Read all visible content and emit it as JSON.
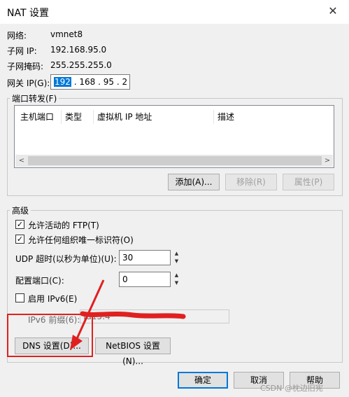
{
  "window": {
    "title": "NAT 设置",
    "close_glyph": "✕"
  },
  "info": {
    "network_label": "网络:",
    "network_value": "vmnet8",
    "subnet_ip_label": "子网 IP:",
    "subnet_ip_value": "192.168.95.0",
    "subnet_mask_label": "子网掩码:",
    "subnet_mask_value": "255.255.255.0",
    "gateway_label": "网关 IP(G):",
    "gateway_octets": [
      "192",
      "168",
      "95",
      "2"
    ]
  },
  "port_forwarding": {
    "label": "端口转发(F)",
    "columns": [
      "主机端口",
      "类型",
      "虚拟机 IP 地址",
      "描述"
    ],
    "rows": [],
    "add_label": "添加(A)...",
    "remove_label": "移除(R)",
    "properties_label": "属性(P)"
  },
  "advanced": {
    "label": "高级",
    "allow_ftp_label": "允许活动的 FTP(T)",
    "allow_ftp_checked": true,
    "allow_uuid_label": "允许任何组织唯一标识符(O)",
    "allow_uuid_checked": true,
    "udp_timeout_label": "UDP 超时(以秒为单位)(U):",
    "udp_timeout_value": "30",
    "config_port_label": "配置端口(C):",
    "config_port_value": "0",
    "enable_ipv6_label": "启用 IPv6(E)",
    "enable_ipv6_checked": false,
    "ipv6_prefix_label": "IPv6 前缀(6):",
    "ipv6_prefix_value": "fd15:4"
  },
  "buttons": {
    "dns": "DNS 设置(D)...",
    "netbios": "NetBIOS 设置(N)...",
    "ok": "确定",
    "cancel": "取消",
    "help": "帮助"
  },
  "watermark": "CSDN @枕边旧宪",
  "annotation_color": "#e02020"
}
